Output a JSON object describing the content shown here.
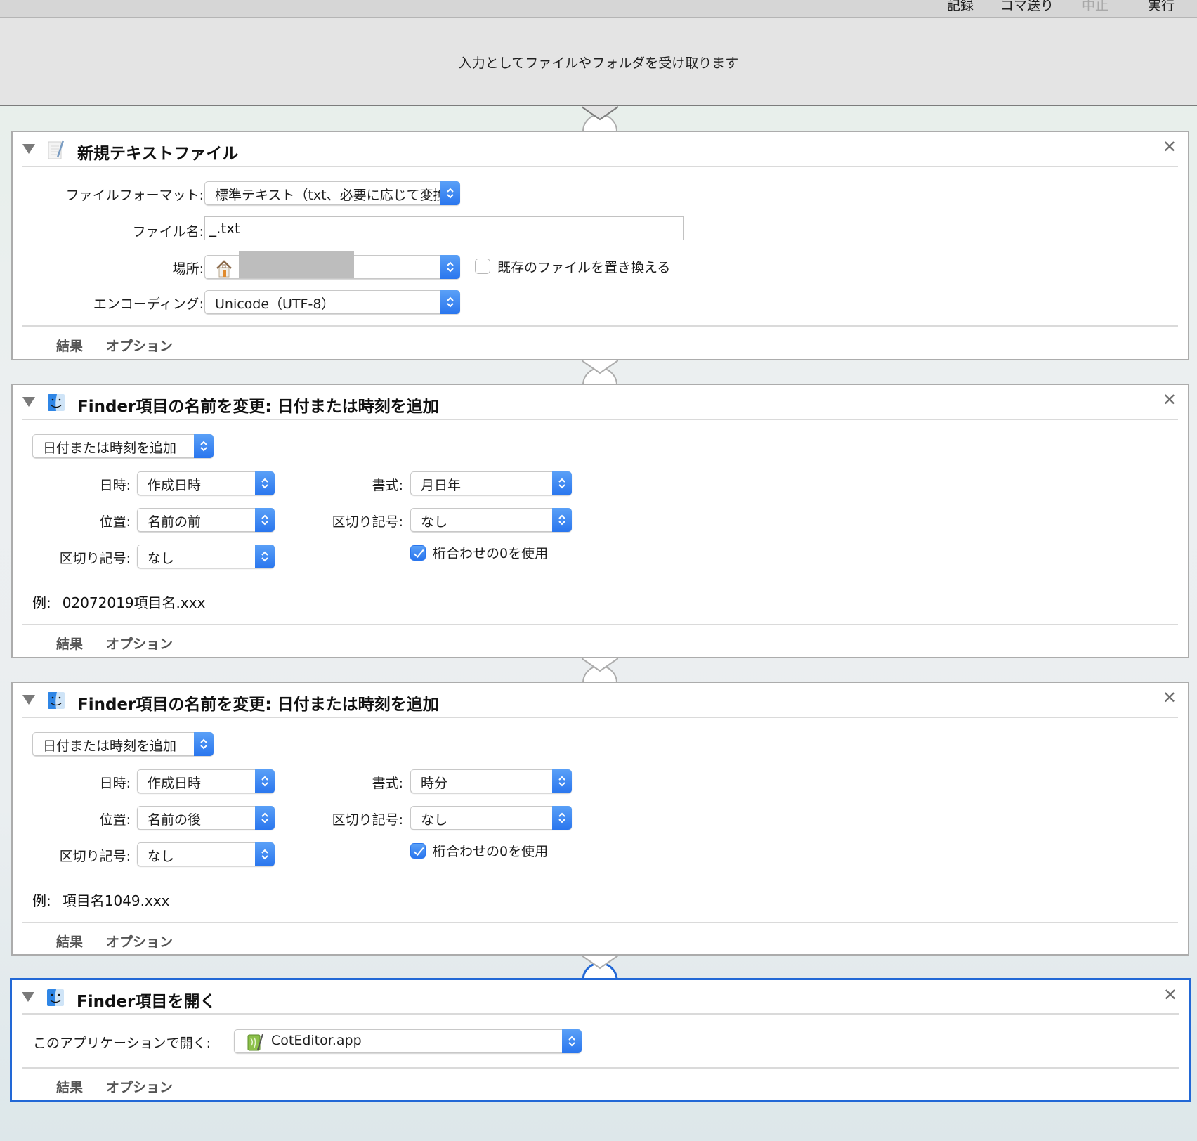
{
  "toolbar": {
    "buttons": [
      {
        "label": "記録",
        "enabled": true
      },
      {
        "label": "コマ送り",
        "enabled": true
      },
      {
        "label": "中止",
        "enabled": false
      },
      {
        "label": "実行",
        "enabled": true
      }
    ]
  },
  "workflow": {
    "input_description": "入力としてファイルやフォルダを受け取ります"
  },
  "footer_tabs": {
    "results": "結果",
    "options": "オプション"
  },
  "actions": [
    {
      "title": "新規テキストファイル",
      "icon": "text-document-icon",
      "fields": {
        "format_label": "ファイルフォーマット:",
        "format_value": "標準テキスト（txt、必要に応じて変換）",
        "filename_label": "ファイル名:",
        "filename_value": "_.txt",
        "location_label": "場所:",
        "location_value": "",
        "replace_label": "既存のファイルを置き換える",
        "replace_checked": false,
        "encoding_label": "エンコーディング:",
        "encoding_value": "Unicode（UTF-8）"
      }
    },
    {
      "title": "Finder項目の名前を変更: 日付または時刻を追加",
      "icon": "finder-icon",
      "mode": "日付または時刻を追加",
      "date_label": "日時:",
      "date_value": "作成日時",
      "position_label": "位置:",
      "position_value": "名前の前",
      "separator_label": "区切り記号:",
      "separator_value": "なし",
      "format_label": "書式:",
      "format_value": "月日年",
      "format_separator_label": "区切り記号:",
      "format_separator_value": "なし",
      "zero_pad_label": "桁合わせの0を使用",
      "zero_pad_checked": true,
      "example_label": "例:",
      "example_value": "02072019項目名.xxx"
    },
    {
      "title": "Finder項目の名前を変更: 日付または時刻を追加",
      "icon": "finder-icon",
      "mode": "日付または時刻を追加",
      "date_label": "日時:",
      "date_value": "作成日時",
      "position_label": "位置:",
      "position_value": "名前の後",
      "separator_label": "区切り記号:",
      "separator_value": "なし",
      "format_label": "書式:",
      "format_value": "時分",
      "format_separator_label": "区切り記号:",
      "format_separator_value": "なし",
      "zero_pad_label": "桁合わせの0を使用",
      "zero_pad_checked": true,
      "example_label": "例:",
      "example_value": "項目名1049.xxx"
    },
    {
      "title": "Finder項目を開く",
      "icon": "finder-icon",
      "open_with_label": "このアプリケーションで開く:",
      "open_with_value": "CotEditor.app",
      "selected": true
    }
  ],
  "colors": {
    "accent": "#2268d6",
    "stepper_blue": "#2a76ee",
    "card_border": "#acacac"
  }
}
